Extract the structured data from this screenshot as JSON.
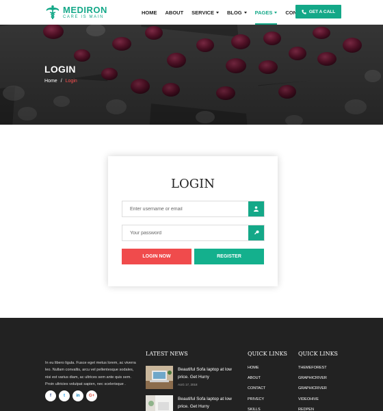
{
  "brand": {
    "name": "MEDIRON",
    "tagline": "CARE IS MAIN",
    "color": "#14a888"
  },
  "nav": {
    "items": [
      {
        "label": "HOME",
        "has_dropdown": false,
        "active": false
      },
      {
        "label": "ABOUT",
        "has_dropdown": false,
        "active": false
      },
      {
        "label": "SERVICE",
        "has_dropdown": true,
        "active": false
      },
      {
        "label": "BLOG",
        "has_dropdown": true,
        "active": false
      },
      {
        "label": "PAGES",
        "has_dropdown": true,
        "active": true
      },
      {
        "label": "CONTACT",
        "has_dropdown": false,
        "active": false
      }
    ]
  },
  "call_button": {
    "label": "GET A CALL",
    "icon": "phone-icon"
  },
  "hero": {
    "title": "LOGIN",
    "breadcrumb": {
      "home": "Home",
      "separator": "/",
      "current": "Login"
    }
  },
  "login": {
    "title": "LOGIN",
    "username_placeholder": "Enter username or email",
    "username_icon": "user-icon",
    "password_placeholder": "Your password",
    "password_icon": "key-icon",
    "login_button": "LOGIN NOW",
    "register_button": "REGISTER",
    "colors": {
      "login": "#f04b4c",
      "register": "#14b08d"
    }
  },
  "footer": {
    "about": "In eu libero ligula. Fusce eget metus lorem, ac viverra leo. Nullam convallis, arcu vel pellentesque sodales, nisi est varius diam, ac ultrices sem ante quis sem. Proin ultricies volutpat sapien, nec scelerisque .",
    "social": [
      {
        "icon": "facebook-icon",
        "glyph": "f",
        "color": "#3b5998"
      },
      {
        "icon": "twitter-icon",
        "glyph": "t",
        "color": "#1da1f2"
      },
      {
        "icon": "linkedin-icon",
        "glyph": "in",
        "color": "#0077b5"
      },
      {
        "icon": "google-plus-icon",
        "glyph": "G+",
        "color": "#dd4b39"
      }
    ],
    "latest_news": {
      "heading": "LATEST NEWS",
      "items": [
        {
          "title": "Beautiful Sofa laptop at low price. Get Hurry",
          "date": "AUG 17, 2018"
        },
        {
          "title": "Beautiful Sofa laptop at low price. Get Hurry",
          "date": ""
        }
      ]
    },
    "quick_links_1": {
      "heading": "QUICK LINKS",
      "items": [
        "HOME",
        "ABOUT",
        "CONTACT",
        "PRIVECY",
        "SKILLS"
      ]
    },
    "quick_links_2": {
      "heading": "QUICK LINKS",
      "items": [
        "THEMEFOREST",
        "GRAPHICRIVER",
        "GRAPHICRIVER",
        "VIDEOHIVE",
        "REDPEN"
      ]
    }
  }
}
